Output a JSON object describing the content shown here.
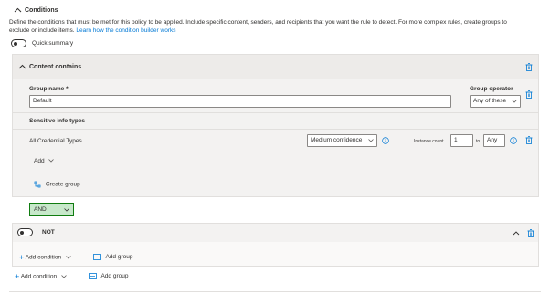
{
  "header": {
    "title": "Conditions",
    "description_line1": "Define the conditions that must be met for this policy to be applied. Include specific content, senders, and recipients that you want the rule to detect. For more complex rules, create groups to",
    "description_line2": "exclude or include items.",
    "learn_link": "Learn how the condition builder works",
    "quick_summary_label": "Quick summary"
  },
  "content_contains": {
    "title": "Content contains",
    "group_name_label": "Group name *",
    "group_name_value": "Default",
    "group_operator_label": "Group operator",
    "group_operator_value": "Any of these",
    "sensitive_info_types_label": "Sensitive info types",
    "row": {
      "name": "All Credential Types",
      "confidence": "Medium confidence",
      "instance_count_label": "Instance count",
      "instance_min": "1",
      "to_label": "to",
      "instance_max": "Any"
    },
    "add_label": "Add",
    "create_group_label": "Create group"
  },
  "and_operator": {
    "value": "AND"
  },
  "not_group": {
    "label": "NOT",
    "add_condition_label": "Add condition",
    "add_group_label": "Add group"
  },
  "footer": {
    "add_condition_label": "Add condition",
    "add_group_label": "Add group"
  },
  "colors": {
    "accent": "#0078d4",
    "and_fill": "#c7e8ca",
    "and_border": "#107c10",
    "panel_bg": "#f3f2f1"
  }
}
